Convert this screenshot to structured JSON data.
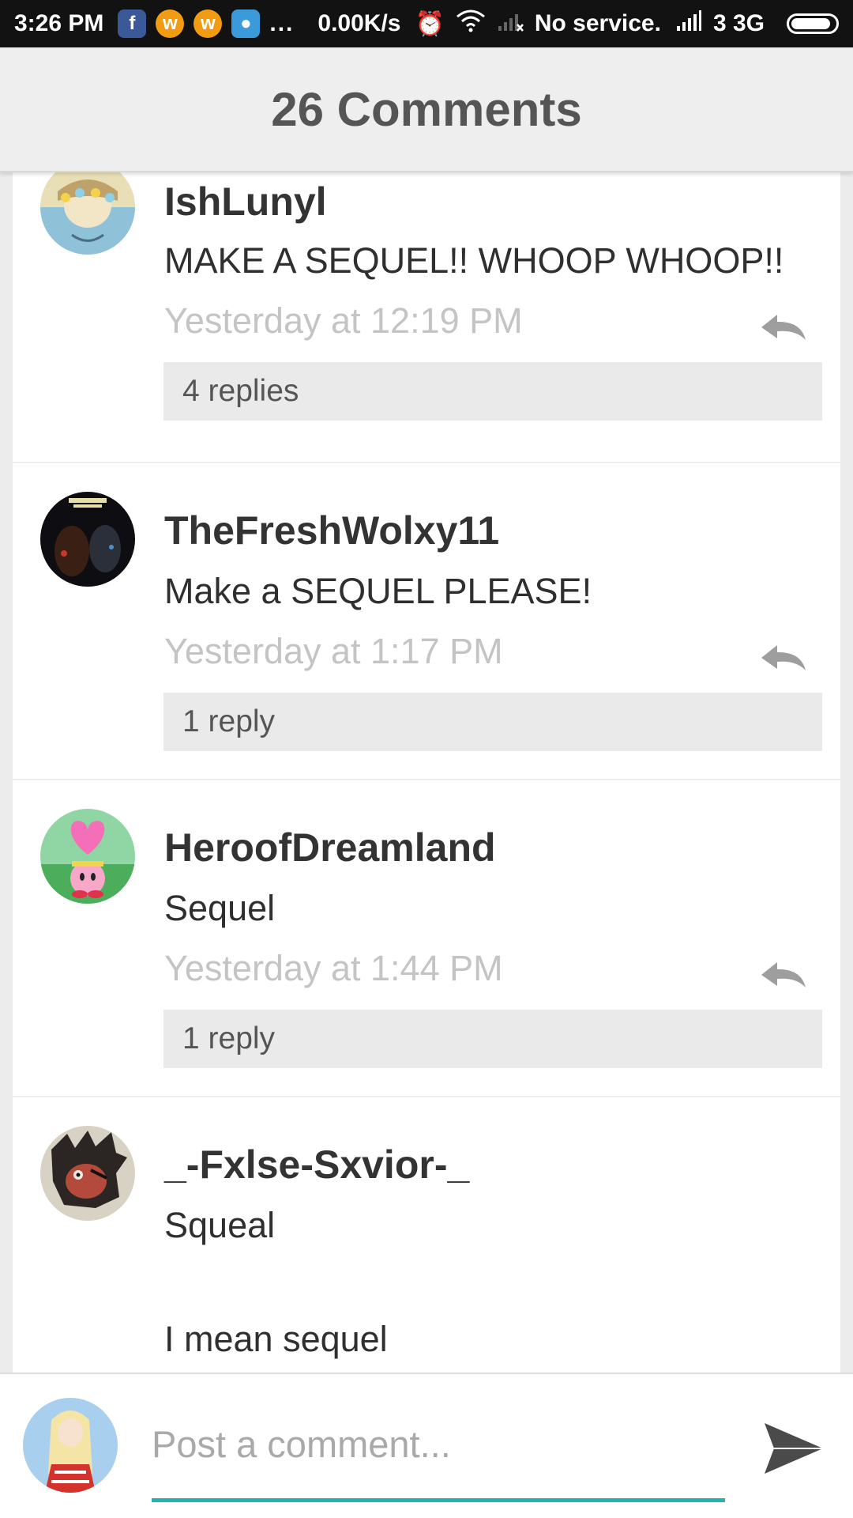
{
  "status_bar": {
    "time": "3:26 PM",
    "app_icons": [
      "facebook-icon",
      "wattpad-icon",
      "wattpad-icon",
      "messenger-icon"
    ],
    "more": "...",
    "net_speed": "0.00K/s",
    "alarm_icon": "alarm-icon",
    "wifi_icon": "wifi-icon",
    "no_signal_icon": "no-signal-icon",
    "carrier": "No service.",
    "signal_icon": "signal-icon",
    "network": "3 3G",
    "battery_level": 0.9
  },
  "header": {
    "title": "26 Comments"
  },
  "comments": [
    {
      "author": "IshLunyl",
      "body": "MAKE A SEQUEL!! WHOOP WHOOP!!",
      "time": "Yesterday at 12:19 PM",
      "replies": "4 replies"
    },
    {
      "author": "TheFreshWolxy11",
      "body": "Make a SEQUEL PLEASE!",
      "time": "Yesterday at 1:17 PM",
      "replies": "1 reply"
    },
    {
      "author": "HeroofDreamland",
      "body": "Sequel",
      "time": "Yesterday at 1:44 PM",
      "replies": "1 reply"
    },
    {
      "author": "_-Fxlse-Sxvior-_",
      "body_line1": "Squeal",
      "body_line2": "I mean sequel"
    }
  ],
  "compose": {
    "placeholder": "Post a comment...",
    "accent_color": "#25b3a9",
    "send_icon": "send-icon"
  }
}
